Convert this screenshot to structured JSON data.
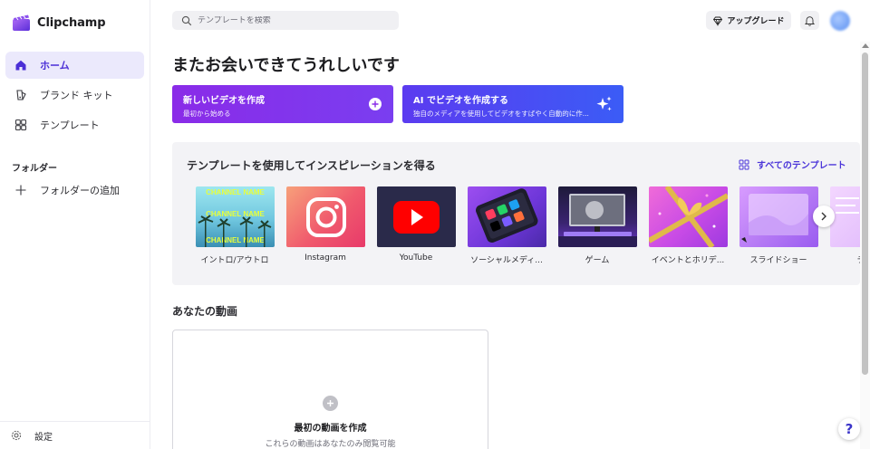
{
  "app": {
    "name": "Clipchamp"
  },
  "sidebar": {
    "items": [
      {
        "label": "ホーム",
        "icon": "home-icon",
        "active": true
      },
      {
        "label": "ブランド キット",
        "icon": "brand-kit-icon",
        "active": false
      },
      {
        "label": "テンプレート",
        "icon": "templates-icon",
        "active": false
      }
    ],
    "folder_heading": "フォルダー",
    "add_folder_label": "フォルダーの追加",
    "settings_label": "設定"
  },
  "topbar": {
    "search_placeholder": "テンプレートを検索",
    "upgrade_label": "アップグレード"
  },
  "main": {
    "welcome": "またお会いできてうれしいです",
    "actions": [
      {
        "title": "新しいビデオを作成",
        "subtitle": "最初から始める"
      },
      {
        "title": "AI でビデオを作成する",
        "subtitle": "独自のメディアを使用してビデオをすばやく自動的に作..."
      }
    ],
    "templates": {
      "title": "テンプレートを使用してインスピレーションを得る",
      "see_all": "すべてのテンプレート",
      "items": [
        {
          "label": "イントロ/アウトロ",
          "thumb_text": "CHANNEL NAME"
        },
        {
          "label": "Instagram"
        },
        {
          "label": "YouTube"
        },
        {
          "label": "ソーシャルメディ..."
        },
        {
          "label": "ゲーム"
        },
        {
          "label": "イベントとホリデ..."
        },
        {
          "label": "スライドショー"
        },
        {
          "label": "テキス"
        }
      ]
    },
    "videos": {
      "heading": "あなたの動画",
      "create_title": "最初の動画を作成",
      "create_subtitle": "これらの動画はあなたのみ閲覧可能"
    }
  },
  "colors": {
    "accent": "#4b35d9",
    "active_bg": "#ebe9fc",
    "panel_bg": "#f3f3f6"
  }
}
